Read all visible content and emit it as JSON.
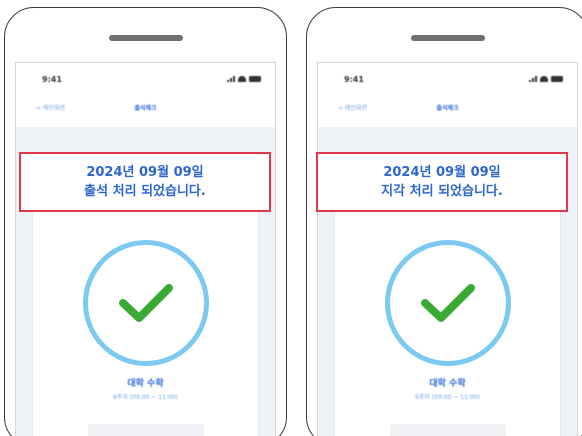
{
  "status": {
    "time": "9:41",
    "icons": [
      "signal-icon",
      "wifi-icon",
      "battery-icon"
    ]
  },
  "nav": {
    "back_label": "< 메인화면",
    "title": "출석체크"
  },
  "screens": [
    {
      "notice_line1": "2024년 09월 09일",
      "notice_line2": "출석 처리 되었습니다.",
      "class_name": "대학 수학",
      "class_time": "6주차 (09:00 ~ 11:00)"
    },
    {
      "notice_line1": "2024년 09월 09일",
      "notice_line2": "지각 처리 되었습니다.",
      "class_name": "대학 수학",
      "class_time": "6주차 (09:00 ~ 11:00)"
    }
  ],
  "colors": {
    "accent_blue": "#2e66cf",
    "highlight_red": "#e03a4a",
    "check_green": "#3aaa35",
    "circle_blue": "#7cc9f1"
  }
}
